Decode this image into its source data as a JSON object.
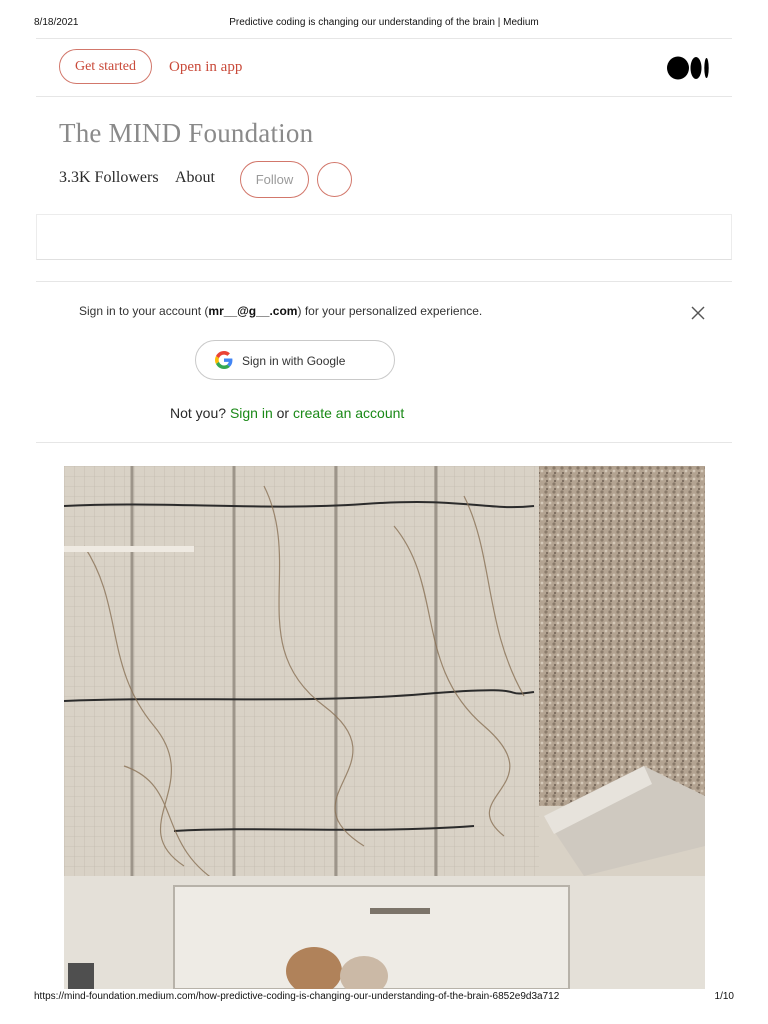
{
  "print": {
    "date": "8/18/2021",
    "title": "Predictive coding is changing our understanding of the brain | Medium",
    "url": "https://mind-foundation.medium.com/how-predictive-coding-is-changing-our-understanding-of-the-brain-6852e9d3a712",
    "page": "1/10"
  },
  "topbar": {
    "get_started": "Get started",
    "open_in_app": "Open in app",
    "logo_icon": "medium-logo"
  },
  "publication": {
    "title": "The MIND Foundation",
    "followers": "3.3K Followers",
    "about": "About",
    "follow": "Follow",
    "more_icon": "more-icon"
  },
  "signin_prompt": {
    "text_before": "Sign in to your account (",
    "email": "mr__@g__.com",
    "text_after": ") for your personalized experience.",
    "google_button": "Sign in with Google",
    "not_you": "Not you?",
    "sign_in": "Sign in",
    "or": "or",
    "create_account": "create an account"
  },
  "colors": {
    "accent": "#c94a3a",
    "link_green": "#1a8917",
    "border_accent": "#d2776b"
  }
}
